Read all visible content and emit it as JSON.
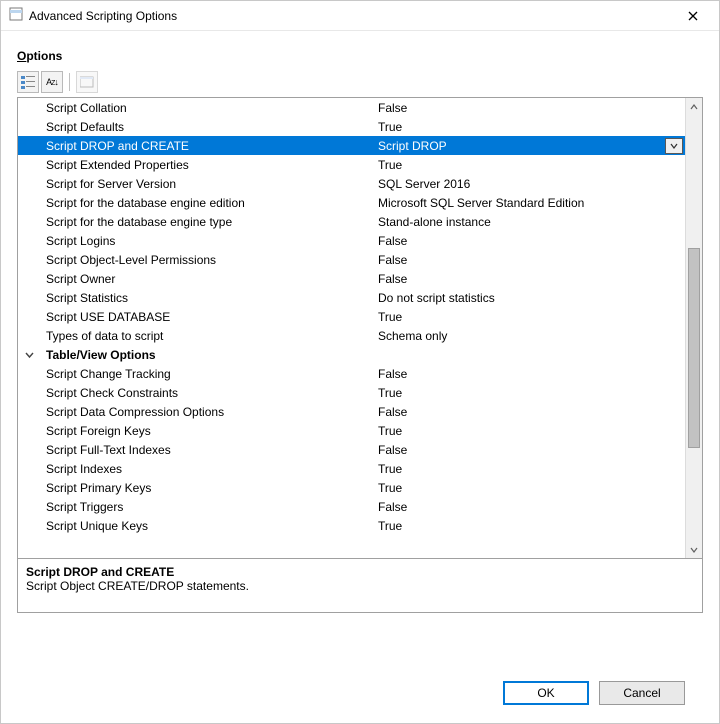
{
  "window": {
    "title": "Advanced Scripting Options"
  },
  "section_label": "Options",
  "toolbar": {
    "categorized_tip": "Categorized",
    "alphabetical_tip": "Alphabetical",
    "propertypages_tip": "Property Pages"
  },
  "grid": {
    "rows": [
      {
        "type": "prop",
        "name": "Script Collation",
        "value": "False"
      },
      {
        "type": "prop",
        "name": "Script Defaults",
        "value": "True"
      },
      {
        "type": "prop",
        "name": "Script DROP and CREATE",
        "value": "Script DROP",
        "selected": true,
        "dropdown": true
      },
      {
        "type": "prop",
        "name": "Script Extended Properties",
        "value": "True"
      },
      {
        "type": "prop",
        "name": "Script for Server Version",
        "value": "SQL Server 2016"
      },
      {
        "type": "prop",
        "name": "Script for the database engine edition",
        "value": "Microsoft SQL Server Standard Edition"
      },
      {
        "type": "prop",
        "name": "Script for the database engine type",
        "value": "Stand-alone instance"
      },
      {
        "type": "prop",
        "name": "Script Logins",
        "value": "False"
      },
      {
        "type": "prop",
        "name": "Script Object-Level Permissions",
        "value": "False"
      },
      {
        "type": "prop",
        "name": "Script Owner",
        "value": "False"
      },
      {
        "type": "prop",
        "name": "Script Statistics",
        "value": "Do not script statistics"
      },
      {
        "type": "prop",
        "name": "Script USE DATABASE",
        "value": "True"
      },
      {
        "type": "prop",
        "name": "Types of data to script",
        "value": "Schema only"
      },
      {
        "type": "cat",
        "name": "Table/View Options"
      },
      {
        "type": "prop",
        "name": "Script Change Tracking",
        "value": "False"
      },
      {
        "type": "prop",
        "name": "Script Check Constraints",
        "value": "True"
      },
      {
        "type": "prop",
        "name": "Script Data Compression Options",
        "value": "False"
      },
      {
        "type": "prop",
        "name": "Script Foreign Keys",
        "value": "True"
      },
      {
        "type": "prop",
        "name": "Script Full-Text Indexes",
        "value": "False"
      },
      {
        "type": "prop",
        "name": "Script Indexes",
        "value": "True"
      },
      {
        "type": "prop",
        "name": "Script Primary Keys",
        "value": "True"
      },
      {
        "type": "prop",
        "name": "Script Triggers",
        "value": "False"
      },
      {
        "type": "prop",
        "name": "Script Unique Keys",
        "value": "True"
      }
    ]
  },
  "description": {
    "title": "Script DROP and CREATE",
    "text": "Script Object CREATE/DROP statements."
  },
  "buttons": {
    "ok": "OK",
    "cancel": "Cancel"
  }
}
